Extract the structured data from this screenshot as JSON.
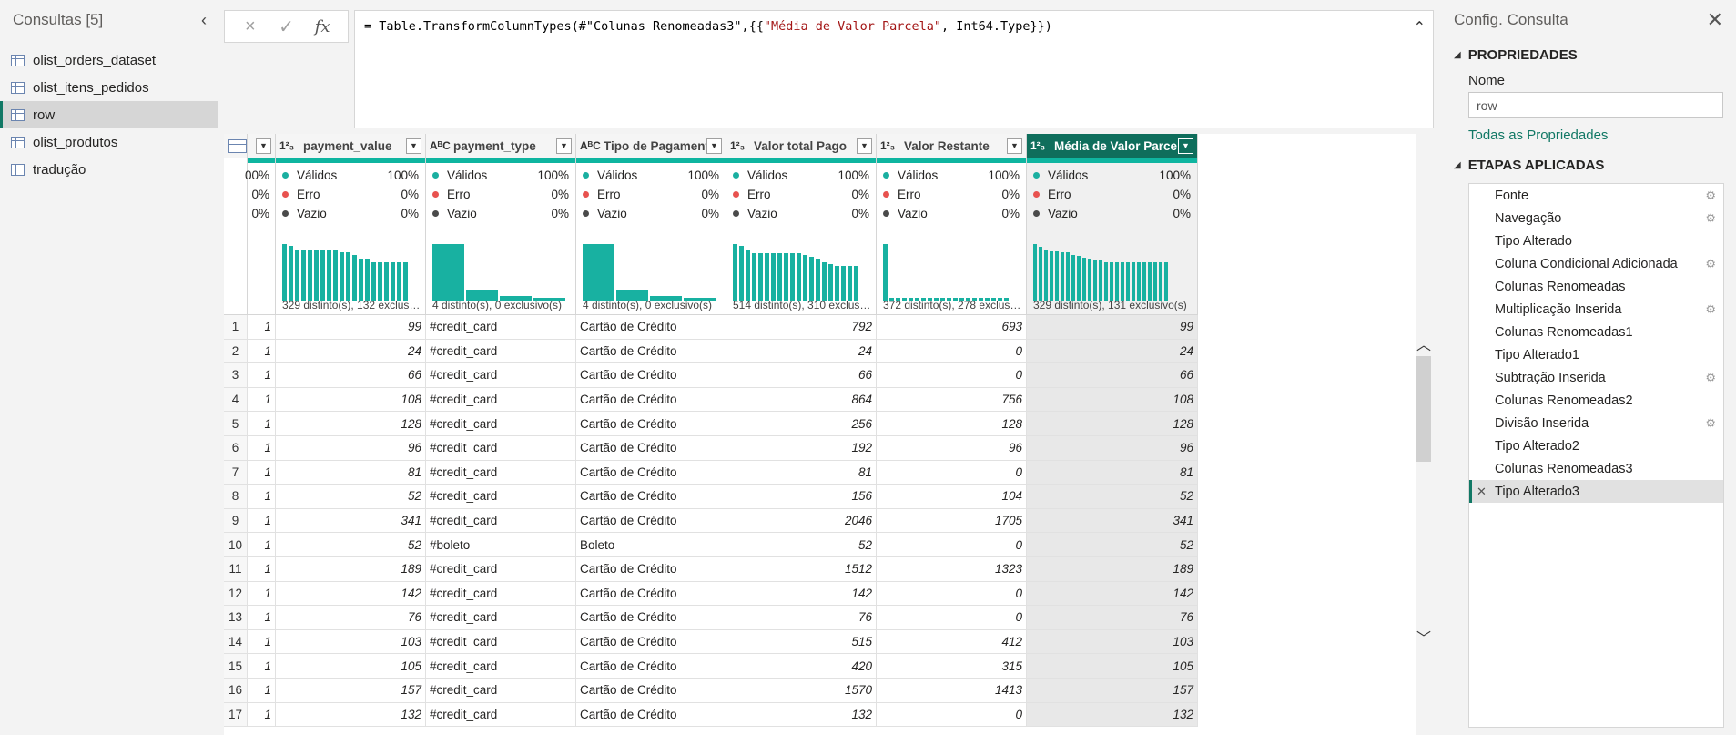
{
  "queries_pane": {
    "title": "Consultas [5]",
    "items": [
      {
        "label": "olist_orders_dataset",
        "active": false
      },
      {
        "label": "olist_itens_pedidos",
        "active": false
      },
      {
        "label": "row",
        "active": true
      },
      {
        "label": "olist_produtos",
        "active": false
      },
      {
        "label": "tradução",
        "active": false
      }
    ]
  },
  "formula_bar": {
    "cancel_icon": "×",
    "confirm_icon": "✓",
    "fx_label": "fx",
    "prefix": "= Table.TransformColumnTypes(#\"Colunas Renomeadas3\",{{",
    "string_part": "\"Média de Valor Parcela\"",
    "suffix": ", Int64.Type}})"
  },
  "table": {
    "columns": [
      {
        "type": "",
        "name": "",
        "partial_pct": [
          "00%",
          "0%",
          "0%"
        ]
      },
      {
        "type": "1²₃",
        "name": "payment_value",
        "selected": false,
        "valid": "100%",
        "error": "0%",
        "empty": "0%",
        "footer": "329 distinto(s), 132 exclusivo(..."
      },
      {
        "type": "AᴮC",
        "name": "payment_type",
        "selected": false,
        "valid": "100%",
        "error": "0%",
        "empty": "0%",
        "footer": "4 distinto(s), 0 exclusivo(s)"
      },
      {
        "type": "AᴮC",
        "name": "Tipo de Pagamento",
        "selected": false,
        "valid": "100%",
        "error": "0%",
        "empty": "0%",
        "footer": "4 distinto(s), 0 exclusivo(s)"
      },
      {
        "type": "1²₃",
        "name": "Valor total Pago",
        "selected": false,
        "valid": "100%",
        "error": "0%",
        "empty": "0%",
        "footer": "514 distinto(s), 310 exclusivo..."
      },
      {
        "type": "1²₃",
        "name": "Valor Restante",
        "selected": false,
        "valid": "100%",
        "error": "0%",
        "empty": "0%",
        "footer": "372 distinto(s), 278 exclusivo(..."
      },
      {
        "type": "1²₃",
        "name": "Média de Valor Parcela",
        "selected": true,
        "valid": "100%",
        "error": "0%",
        "empty": "0%",
        "footer": "329 distinto(s), 131 exclusivo(s)"
      }
    ],
    "quality_labels": {
      "valid": "Válidos",
      "error": "Erro",
      "empty": "Vazio"
    },
    "quality_colors": {
      "valid": "#1aafa0",
      "error": "#e8524f",
      "empty": "#4a4a4a"
    },
    "rows": [
      {
        "idx": "1",
        "c0": "1",
        "c1": "99",
        "c2": "#credit_card",
        "c3": "Cartão de Crédito",
        "c4": "792",
        "c5": "693",
        "c6": "99"
      },
      {
        "idx": "2",
        "c0": "1",
        "c1": "24",
        "c2": "#credit_card",
        "c3": "Cartão de Crédito",
        "c4": "24",
        "c5": "0",
        "c6": "24"
      },
      {
        "idx": "3",
        "c0": "1",
        "c1": "66",
        "c2": "#credit_card",
        "c3": "Cartão de Crédito",
        "c4": "66",
        "c5": "0",
        "c6": "66"
      },
      {
        "idx": "4",
        "c0": "1",
        "c1": "108",
        "c2": "#credit_card",
        "c3": "Cartão de Crédito",
        "c4": "864",
        "c5": "756",
        "c6": "108"
      },
      {
        "idx": "5",
        "c0": "1",
        "c1": "128",
        "c2": "#credit_card",
        "c3": "Cartão de Crédito",
        "c4": "256",
        "c5": "128",
        "c6": "128"
      },
      {
        "idx": "6",
        "c0": "1",
        "c1": "96",
        "c2": "#credit_card",
        "c3": "Cartão de Crédito",
        "c4": "192",
        "c5": "96",
        "c6": "96"
      },
      {
        "idx": "7",
        "c0": "1",
        "c1": "81",
        "c2": "#credit_card",
        "c3": "Cartão de Crédito",
        "c4": "81",
        "c5": "0",
        "c6": "81"
      },
      {
        "idx": "8",
        "c0": "1",
        "c1": "52",
        "c2": "#credit_card",
        "c3": "Cartão de Crédito",
        "c4": "156",
        "c5": "104",
        "c6": "52"
      },
      {
        "idx": "9",
        "c0": "1",
        "c1": "341",
        "c2": "#credit_card",
        "c3": "Cartão de Crédito",
        "c4": "2046",
        "c5": "1705",
        "c6": "341"
      },
      {
        "idx": "10",
        "c0": "1",
        "c1": "52",
        "c2": "#boleto",
        "c3": "Boleto",
        "c4": "52",
        "c5": "0",
        "c6": "52"
      },
      {
        "idx": "11",
        "c0": "1",
        "c1": "189",
        "c2": "#credit_card",
        "c3": "Cartão de Crédito",
        "c4": "1512",
        "c5": "1323",
        "c6": "189"
      },
      {
        "idx": "12",
        "c0": "1",
        "c1": "142",
        "c2": "#credit_card",
        "c3": "Cartão de Crédito",
        "c4": "142",
        "c5": "0",
        "c6": "142"
      },
      {
        "idx": "13",
        "c0": "1",
        "c1": "76",
        "c2": "#credit_card",
        "c3": "Cartão de Crédito",
        "c4": "76",
        "c5": "0",
        "c6": "76"
      },
      {
        "idx": "14",
        "c0": "1",
        "c1": "103",
        "c2": "#credit_card",
        "c3": "Cartão de Crédito",
        "c4": "515",
        "c5": "412",
        "c6": "103"
      },
      {
        "idx": "15",
        "c0": "1",
        "c1": "105",
        "c2": "#credit_card",
        "c3": "Cartão de Crédito",
        "c4": "420",
        "c5": "315",
        "c6": "105"
      },
      {
        "idx": "16",
        "c0": "1",
        "c1": "157",
        "c2": "#credit_card",
        "c3": "Cartão de Crédito",
        "c4": "1570",
        "c5": "1413",
        "c6": "157"
      },
      {
        "idx": "17",
        "c0": "1",
        "c1": "132",
        "c2": "#credit_card",
        "c3": "Cartão de Crédito",
        "c4": "132",
        "c5": "0",
        "c6": "132"
      }
    ]
  },
  "query_settings": {
    "title": "Config. Consulta",
    "properties_heading": "PROPRIEDADES",
    "name_label": "Nome",
    "name_value": "row",
    "all_properties_link": "Todas as Propriedades",
    "steps_heading": "ETAPAS APLICADAS",
    "steps": [
      {
        "label": "Fonte",
        "gear": true,
        "active": false
      },
      {
        "label": "Navegação",
        "gear": true,
        "active": false
      },
      {
        "label": "Tipo Alterado",
        "gear": false,
        "active": false
      },
      {
        "label": "Coluna Condicional Adicionada",
        "gear": true,
        "active": false
      },
      {
        "label": "Colunas Renomeadas",
        "gear": false,
        "active": false
      },
      {
        "label": "Multiplicação Inserida",
        "gear": true,
        "active": false
      },
      {
        "label": "Colunas Renomeadas1",
        "gear": false,
        "active": false
      },
      {
        "label": "Tipo Alterado1",
        "gear": false,
        "active": false
      },
      {
        "label": "Subtração Inserida",
        "gear": true,
        "active": false
      },
      {
        "label": "Colunas Renomeadas2",
        "gear": false,
        "active": false
      },
      {
        "label": "Divisão Inserida",
        "gear": true,
        "active": false
      },
      {
        "label": "Tipo Alterado2",
        "gear": false,
        "active": false
      },
      {
        "label": "Colunas Renomeadas3",
        "gear": false,
        "active": false
      },
      {
        "label": "Tipo Alterado3",
        "gear": false,
        "active": true
      }
    ]
  },
  "accent_color": "#117865"
}
